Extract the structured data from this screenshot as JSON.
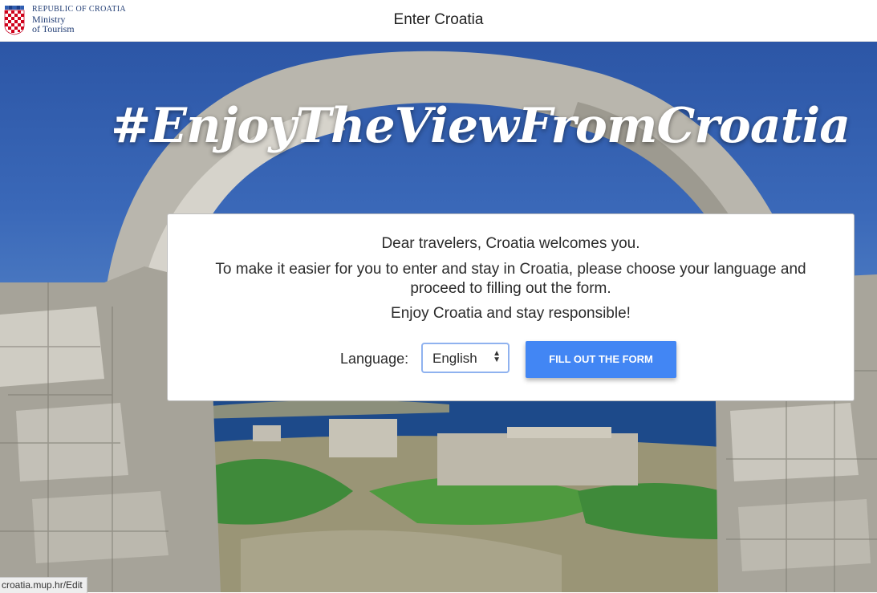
{
  "header": {
    "logo_line1": "REPUBLIC OF CROATIA",
    "logo_line2": "Ministry",
    "logo_line3": "of Tourism",
    "title": "Enter Croatia"
  },
  "hero": {
    "hashtag": "#EnjoyTheViewFromCroatia"
  },
  "card": {
    "greeting": "Dear travelers, Croatia welcomes you.",
    "instructions": "To make it easier for you to enter and stay in Croatia, please choose your language and proceed to filling out the form.",
    "closing": "Enjoy Croatia and stay responsible!",
    "language_label": "Language:",
    "language_selected": "English",
    "button_label": "FILL OUT THE FORM"
  },
  "status_bar": {
    "url": "croatia.mup.hr/Edit"
  },
  "colors": {
    "button": "#4286f4",
    "logo_text": "#1f3b73"
  }
}
